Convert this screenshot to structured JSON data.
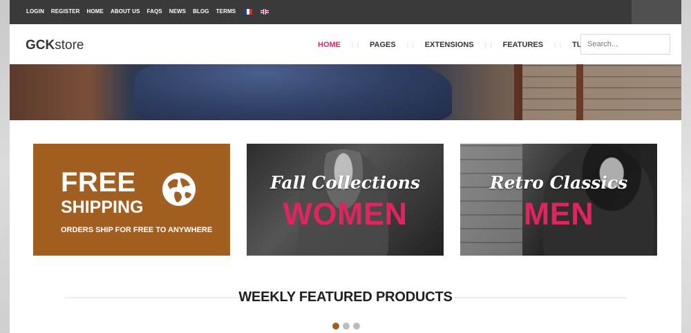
{
  "topbar": {
    "links": [
      "LOGIN",
      "REGISTER",
      "HOME",
      "ABOUT US",
      "FAQS",
      "NEWS",
      "BLOG",
      "TERMS"
    ]
  },
  "header": {
    "logo_bold": "GCK",
    "logo_rest": "store",
    "nav": [
      "HOME",
      "PAGES",
      "EXTENSIONS",
      "FEATURES",
      "TUTORIALS"
    ],
    "active_nav": "HOME",
    "search_placeholder": "Search..."
  },
  "banners": {
    "shipping": {
      "line1": "FREE",
      "line2": "SHIPPING",
      "line3": "ORDERS SHIP FOR FREE TO ANYWHERE"
    },
    "women": {
      "script": "Fall Collections",
      "big": "WOMEN"
    },
    "men": {
      "script": "Retro Classics",
      "big": "MEN"
    }
  },
  "featured": {
    "title": "WEEKLY FEATURED PRODUCTS"
  },
  "carousel": {
    "pages": 3,
    "active": 1
  },
  "colors": {
    "accent": "#e0245e",
    "shipping_bg": "#a15f21",
    "topbar": "#3a3a3a"
  }
}
